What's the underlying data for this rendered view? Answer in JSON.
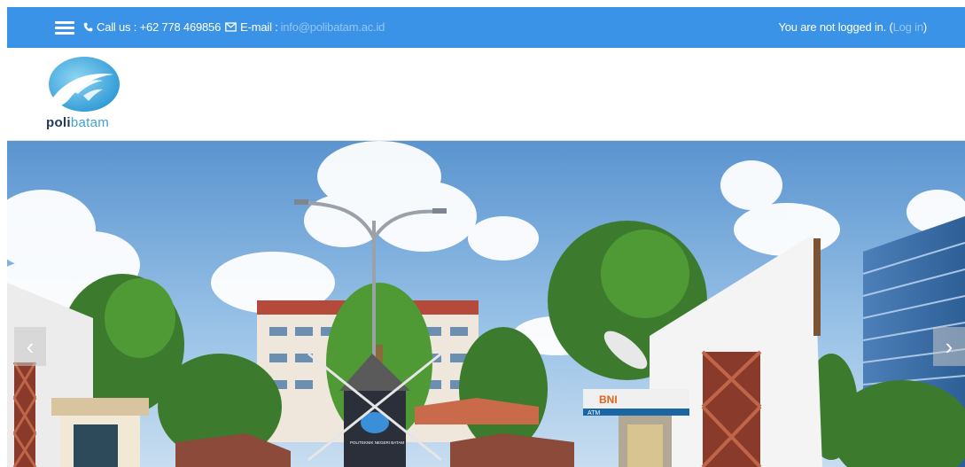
{
  "topbar": {
    "call_label": "Call us : +62 778 469856",
    "email_label": "E-mail :",
    "email_value": "info@polibatam.ac.id",
    "login_prefix": "You are not logged in. (",
    "login_link": "Log in",
    "login_suffix": ")",
    "bg_color": "#3a93e6"
  },
  "header": {
    "logo_text_part1": "poli",
    "logo_text_part2": "batam"
  },
  "hero": {
    "sign_left": "POLITEKNIK NEGERI BATAM",
    "bank_sign": "BNI",
    "bank_sub": "ATM",
    "prev_label": "‹",
    "next_label": "›"
  }
}
